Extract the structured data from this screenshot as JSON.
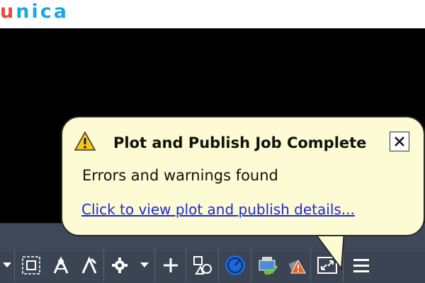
{
  "brand": {
    "logo_first": "u",
    "logo_rest": "nica",
    "logo_color_first": "#e8483c",
    "logo_color_rest": "#1aa7e8"
  },
  "notification": {
    "title": "Plot and Publish Job Complete",
    "message": "Errors and warnings found",
    "link_text": "Click to view plot and publish details...",
    "icon": "warning-icon",
    "close_icon": "close-icon"
  },
  "statusbar": {
    "tools": [
      "dropdown-arrow-icon",
      "viewport-icon",
      "annotation-scale-icon",
      "annotation-visibility-icon",
      "workspace-gear-icon",
      "dropdown-arrow-icon",
      "plus-icon",
      "isolate-objects-icon",
      "hardware-acceleration-icon",
      "plot-publish-status-icon",
      "plot-warning-icon",
      "fullscreen-icon",
      "customization-menu-icon"
    ]
  }
}
